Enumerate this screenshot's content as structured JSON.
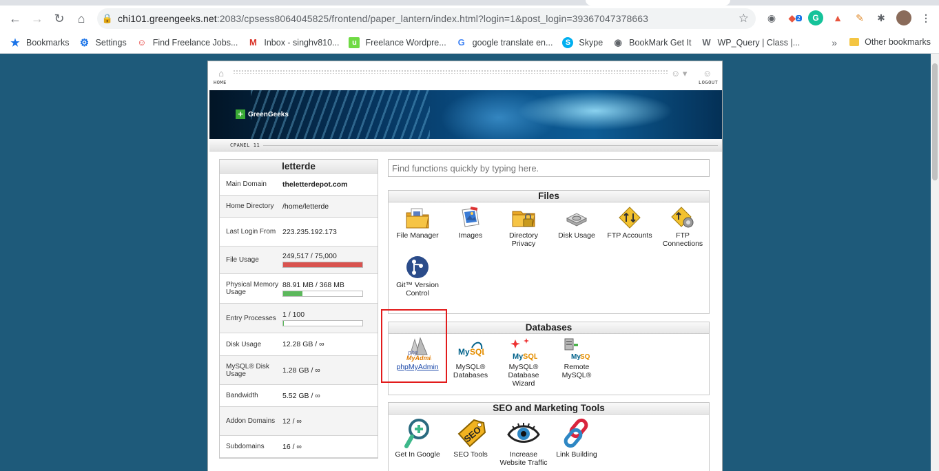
{
  "browser": {
    "url_host": "chi101.greengeeks.net",
    "url_rest": ":2083/cpsess8064045825/frontend/paper_lantern/index.html?login=1&post_login=39367047378663",
    "extension_badge": "2",
    "bookmarks": [
      {
        "label": "Bookmarks",
        "icon": "star-icon",
        "color": "#1a73e8"
      },
      {
        "label": "Settings",
        "icon": "gear-icon",
        "color": "#1a73e8"
      },
      {
        "label": "Find Freelance Jobs...",
        "icon": "freelance-icon",
        "color": "#e53935"
      },
      {
        "label": "Inbox - singhv810...",
        "icon": "gmail-icon",
        "color": "#d93025"
      },
      {
        "label": "Freelance Wordpre...",
        "icon": "upwork-icon",
        "color": "#6fda44"
      },
      {
        "label": "google translate en...",
        "icon": "google-icon",
        "color": "#4285f4"
      },
      {
        "label": "Skype",
        "icon": "skype-icon",
        "color": "#00aff0"
      },
      {
        "label": "BookMark Get It",
        "icon": "globe-icon",
        "color": "#5f6368"
      },
      {
        "label": "WP_Query | Class |...",
        "icon": "wordpress-icon",
        "color": "#5f6368"
      }
    ],
    "other_bookmarks": "Other bookmarks"
  },
  "cpanel": {
    "home_label": "HOME",
    "logout_label": "LOGOUT",
    "brand": "GreenGeeks",
    "strip_label": "CPANEL 11",
    "username": "letterde",
    "search_placeholder": "Find functions quickly by typing here.",
    "stats": [
      {
        "key": "Main Domain",
        "value": "theletterdepot.com",
        "bold": true
      },
      {
        "key": "Home Directory",
        "value": "/home/letterde"
      },
      {
        "key": "Last Login From",
        "value": "223.235.192.173"
      },
      {
        "key": "File Usage",
        "value": "249,517 / 75,000",
        "bar": 1.0,
        "bar_color": "#d9534f"
      },
      {
        "key": "Physical Memory Usage",
        "value": "88.91 MB / 368 MB",
        "bar": 0.24,
        "bar_color": "#5cb85c"
      },
      {
        "key": "Entry Processes",
        "value": "1 / 100",
        "bar": 0.01,
        "bar_color": "#5cb85c"
      },
      {
        "key": "Disk Usage",
        "value": "12.28 GB / ∞"
      },
      {
        "key": "MySQL® Disk Usage",
        "value": "1.28 GB / ∞"
      },
      {
        "key": "Bandwidth",
        "value": "5.52 GB / ∞"
      },
      {
        "key": "Addon Domains",
        "value": "12 / ∞"
      },
      {
        "key": "Subdomains",
        "value": "16 / ∞"
      }
    ],
    "groups": {
      "files": {
        "title": "Files",
        "items": [
          {
            "label": "File Manager",
            "icon": "file-manager-icon"
          },
          {
            "label": "Images",
            "icon": "images-icon"
          },
          {
            "label": "Directory Privacy",
            "icon": "directory-privacy-icon"
          },
          {
            "label": "Disk Usage",
            "icon": "disk-usage-icon"
          },
          {
            "label": "FTP Accounts",
            "icon": "ftp-accounts-icon"
          },
          {
            "label": "FTP Connections",
            "icon": "ftp-connections-icon"
          },
          {
            "label": "Git™ Version Control",
            "icon": "git-icon"
          }
        ]
      },
      "databases": {
        "title": "Databases",
        "items": [
          {
            "label": "phpMyAdmin",
            "icon": "phpmyadmin-icon"
          },
          {
            "label": "MySQL® Databases",
            "icon": "mysql-databases-icon"
          },
          {
            "label": "MySQL® Database Wizard",
            "icon": "mysql-wizard-icon"
          },
          {
            "label": "Remote MySQL®",
            "icon": "remote-mysql-icon"
          }
        ]
      },
      "seo": {
        "title": "SEO and Marketing Tools",
        "items": [
          {
            "label": "Get In Google",
            "icon": "get-in-google-icon"
          },
          {
            "label": "SEO Tools",
            "icon": "seo-tools-icon"
          },
          {
            "label": "Increase Website Traffic",
            "icon": "traffic-eye-icon"
          },
          {
            "label": "Link Building",
            "icon": "link-building-icon"
          }
        ]
      }
    }
  }
}
